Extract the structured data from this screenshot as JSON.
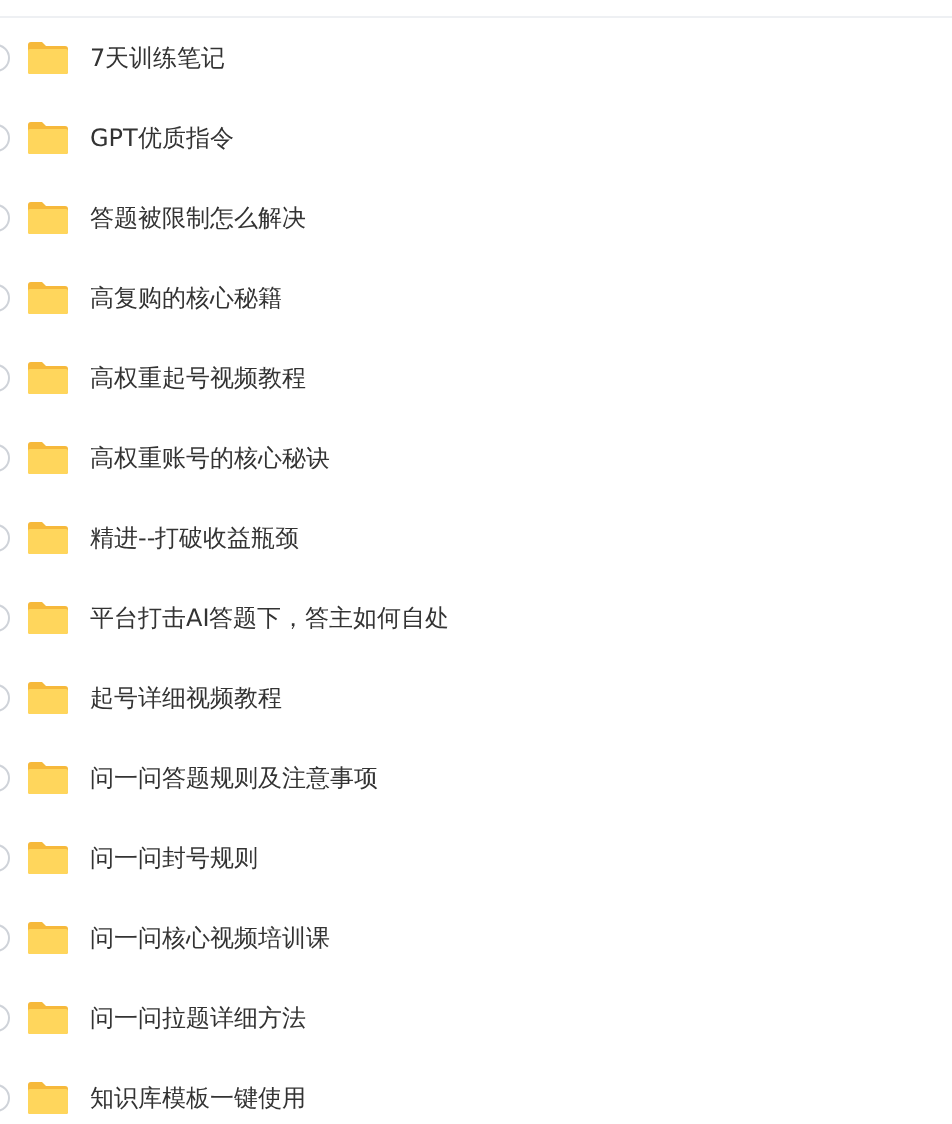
{
  "files": [
    {
      "name": "7天训练笔记",
      "checked": false
    },
    {
      "name": "GPT优质指令",
      "checked": false
    },
    {
      "name": "答题被限制怎么解决",
      "checked": false
    },
    {
      "name": "高复购的核心秘籍",
      "checked": false
    },
    {
      "name": "高权重起号视频教程",
      "checked": false
    },
    {
      "name": "高权重账号的核心秘诀",
      "checked": false
    },
    {
      "name": "精进--打破收益瓶颈",
      "checked": false
    },
    {
      "name": "平台打击AI答题下，答主如何自处",
      "checked": false
    },
    {
      "name": "起号详细视频教程",
      "checked": false
    },
    {
      "name": "问一问答题规则及注意事项",
      "checked": false
    },
    {
      "name": "问一问封号规则",
      "checked": false
    },
    {
      "name": "问一问核心视频培训课",
      "checked": false
    },
    {
      "name": "问一问拉题详细方法",
      "checked": false
    },
    {
      "name": "知识库模板一键使用",
      "checked": false
    }
  ]
}
